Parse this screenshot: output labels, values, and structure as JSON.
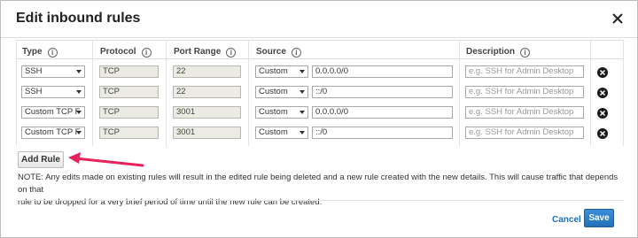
{
  "dialog": {
    "title": "Edit inbound rules",
    "close_icon": "close-icon"
  },
  "table": {
    "headers": {
      "type": "Type",
      "protocol": "Protocol",
      "port_range": "Port Range",
      "source": "Source",
      "description": "Description"
    },
    "info_glyph": "i",
    "rows": [
      {
        "type": "SSH",
        "protocol": "TCP",
        "port": "22",
        "source_mode": "Custom",
        "source_value": "0.0.0.0/0",
        "description_placeholder": "e.g. SSH for Admin Desktop"
      },
      {
        "type": "SSH",
        "protocol": "TCP",
        "port": "22",
        "source_mode": "Custom",
        "source_value": "::/0",
        "description_placeholder": "e.g. SSH for Admin Desktop"
      },
      {
        "type": "Custom TCP F",
        "protocol": "TCP",
        "port": "3001",
        "source_mode": "Custom",
        "source_value": "0.0.0.0/0",
        "description_placeholder": "e.g. SSH for Admin Desktop"
      },
      {
        "type": "Custom TCP F",
        "protocol": "TCP",
        "port": "3001",
        "source_mode": "Custom",
        "source_value": "::/0",
        "description_placeholder": "e.g. SSH for Admin Desktop"
      }
    ]
  },
  "actions": {
    "add_rule": "Add Rule",
    "cancel": "Cancel",
    "save": "Save"
  },
  "note_line1": "NOTE: Any edits made on existing rules will result in the edited rule being deleted and a new rule created with the new details. This will cause traffic that depends on that",
  "note_line2": "rule to be dropped for a very brief period of time until the new rule can be created.",
  "colors": {
    "save_button": "#2a78c2",
    "cancel_link": "#1f6fb8",
    "annotation_arrow": "#e8235c"
  },
  "icons": {
    "info": "info-icon",
    "remove": "remove-circle-icon",
    "dropdown": "chevron-down-icon"
  }
}
